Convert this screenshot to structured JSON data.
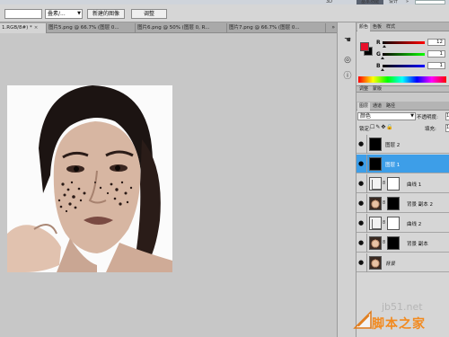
{
  "menubar": {
    "workspaces": [
      "3D",
      "基本功能",
      "设计",
      "»"
    ]
  },
  "options_bar": {
    "style_select": "叠素/...",
    "new_layer_button": "新建的图像",
    "adjust_button": "调整"
  },
  "doc_tabs": [
    {
      "label": "1.RGB/8#) *",
      "active": true
    },
    {
      "label": "图片5.png @ 66.7% (图层 0...",
      "active": false
    },
    {
      "label": "图片6.png @ 50% (图层 0, R...",
      "active": false
    },
    {
      "label": "图片7.png @ 66.7% (图层 0...",
      "active": false
    }
  ],
  "doc_tabs_more": "»",
  "color_panel": {
    "tabs": [
      "颜色",
      "色板",
      "样式"
    ],
    "fg_color": "#e8102a",
    "bg_color": "#000000",
    "channels": [
      {
        "label": "R",
        "value": "12",
        "level": 0.05,
        "gradient_start": "#0c0000",
        "gradient_end": "#ff0000"
      },
      {
        "label": "G",
        "value": "1",
        "level": 0.0,
        "gradient_start": "#0c0100",
        "gradient_end": "#0cff01"
      },
      {
        "label": "B",
        "value": "1",
        "level": 0.0,
        "gradient_start": "#0c0100",
        "gradient_end": "#0c01ff"
      }
    ]
  },
  "adjust_panel": {
    "tabs": [
      "调整",
      "蒙版"
    ]
  },
  "layers_panel": {
    "tabs": [
      "图层",
      "通道",
      "路径"
    ],
    "blend_mode": "颜色",
    "opacity_label": "不透明度:",
    "opacity_value": "10",
    "lock_label": "锁定:",
    "fill_label": "填充:",
    "fill_value": "10",
    "layers": [
      {
        "name": "图层 2",
        "type": "fill",
        "thumb_color": "#000000",
        "selected": false,
        "visible": true
      },
      {
        "name": "图层 1",
        "type": "fill",
        "thumb_color": "#000000",
        "selected": true,
        "visible": true
      },
      {
        "name": "曲线 1",
        "type": "adjustment",
        "mask_color": "#ffffff",
        "selected": false,
        "visible": true
      },
      {
        "name": "背景 副本 2",
        "type": "photo",
        "mask_color": "#000000",
        "selected": false,
        "visible": true
      },
      {
        "name": "曲线 2",
        "type": "adjustment",
        "mask_color": "#ffffff",
        "selected": false,
        "visible": true
      },
      {
        "name": "背景 副本",
        "type": "photo",
        "mask_color": "#000000",
        "selected": false,
        "visible": true
      },
      {
        "name": "背景",
        "type": "photo",
        "selected": false,
        "visible": true
      }
    ]
  },
  "watermark": {
    "site": "jb51.net",
    "label": "脚本之家"
  }
}
